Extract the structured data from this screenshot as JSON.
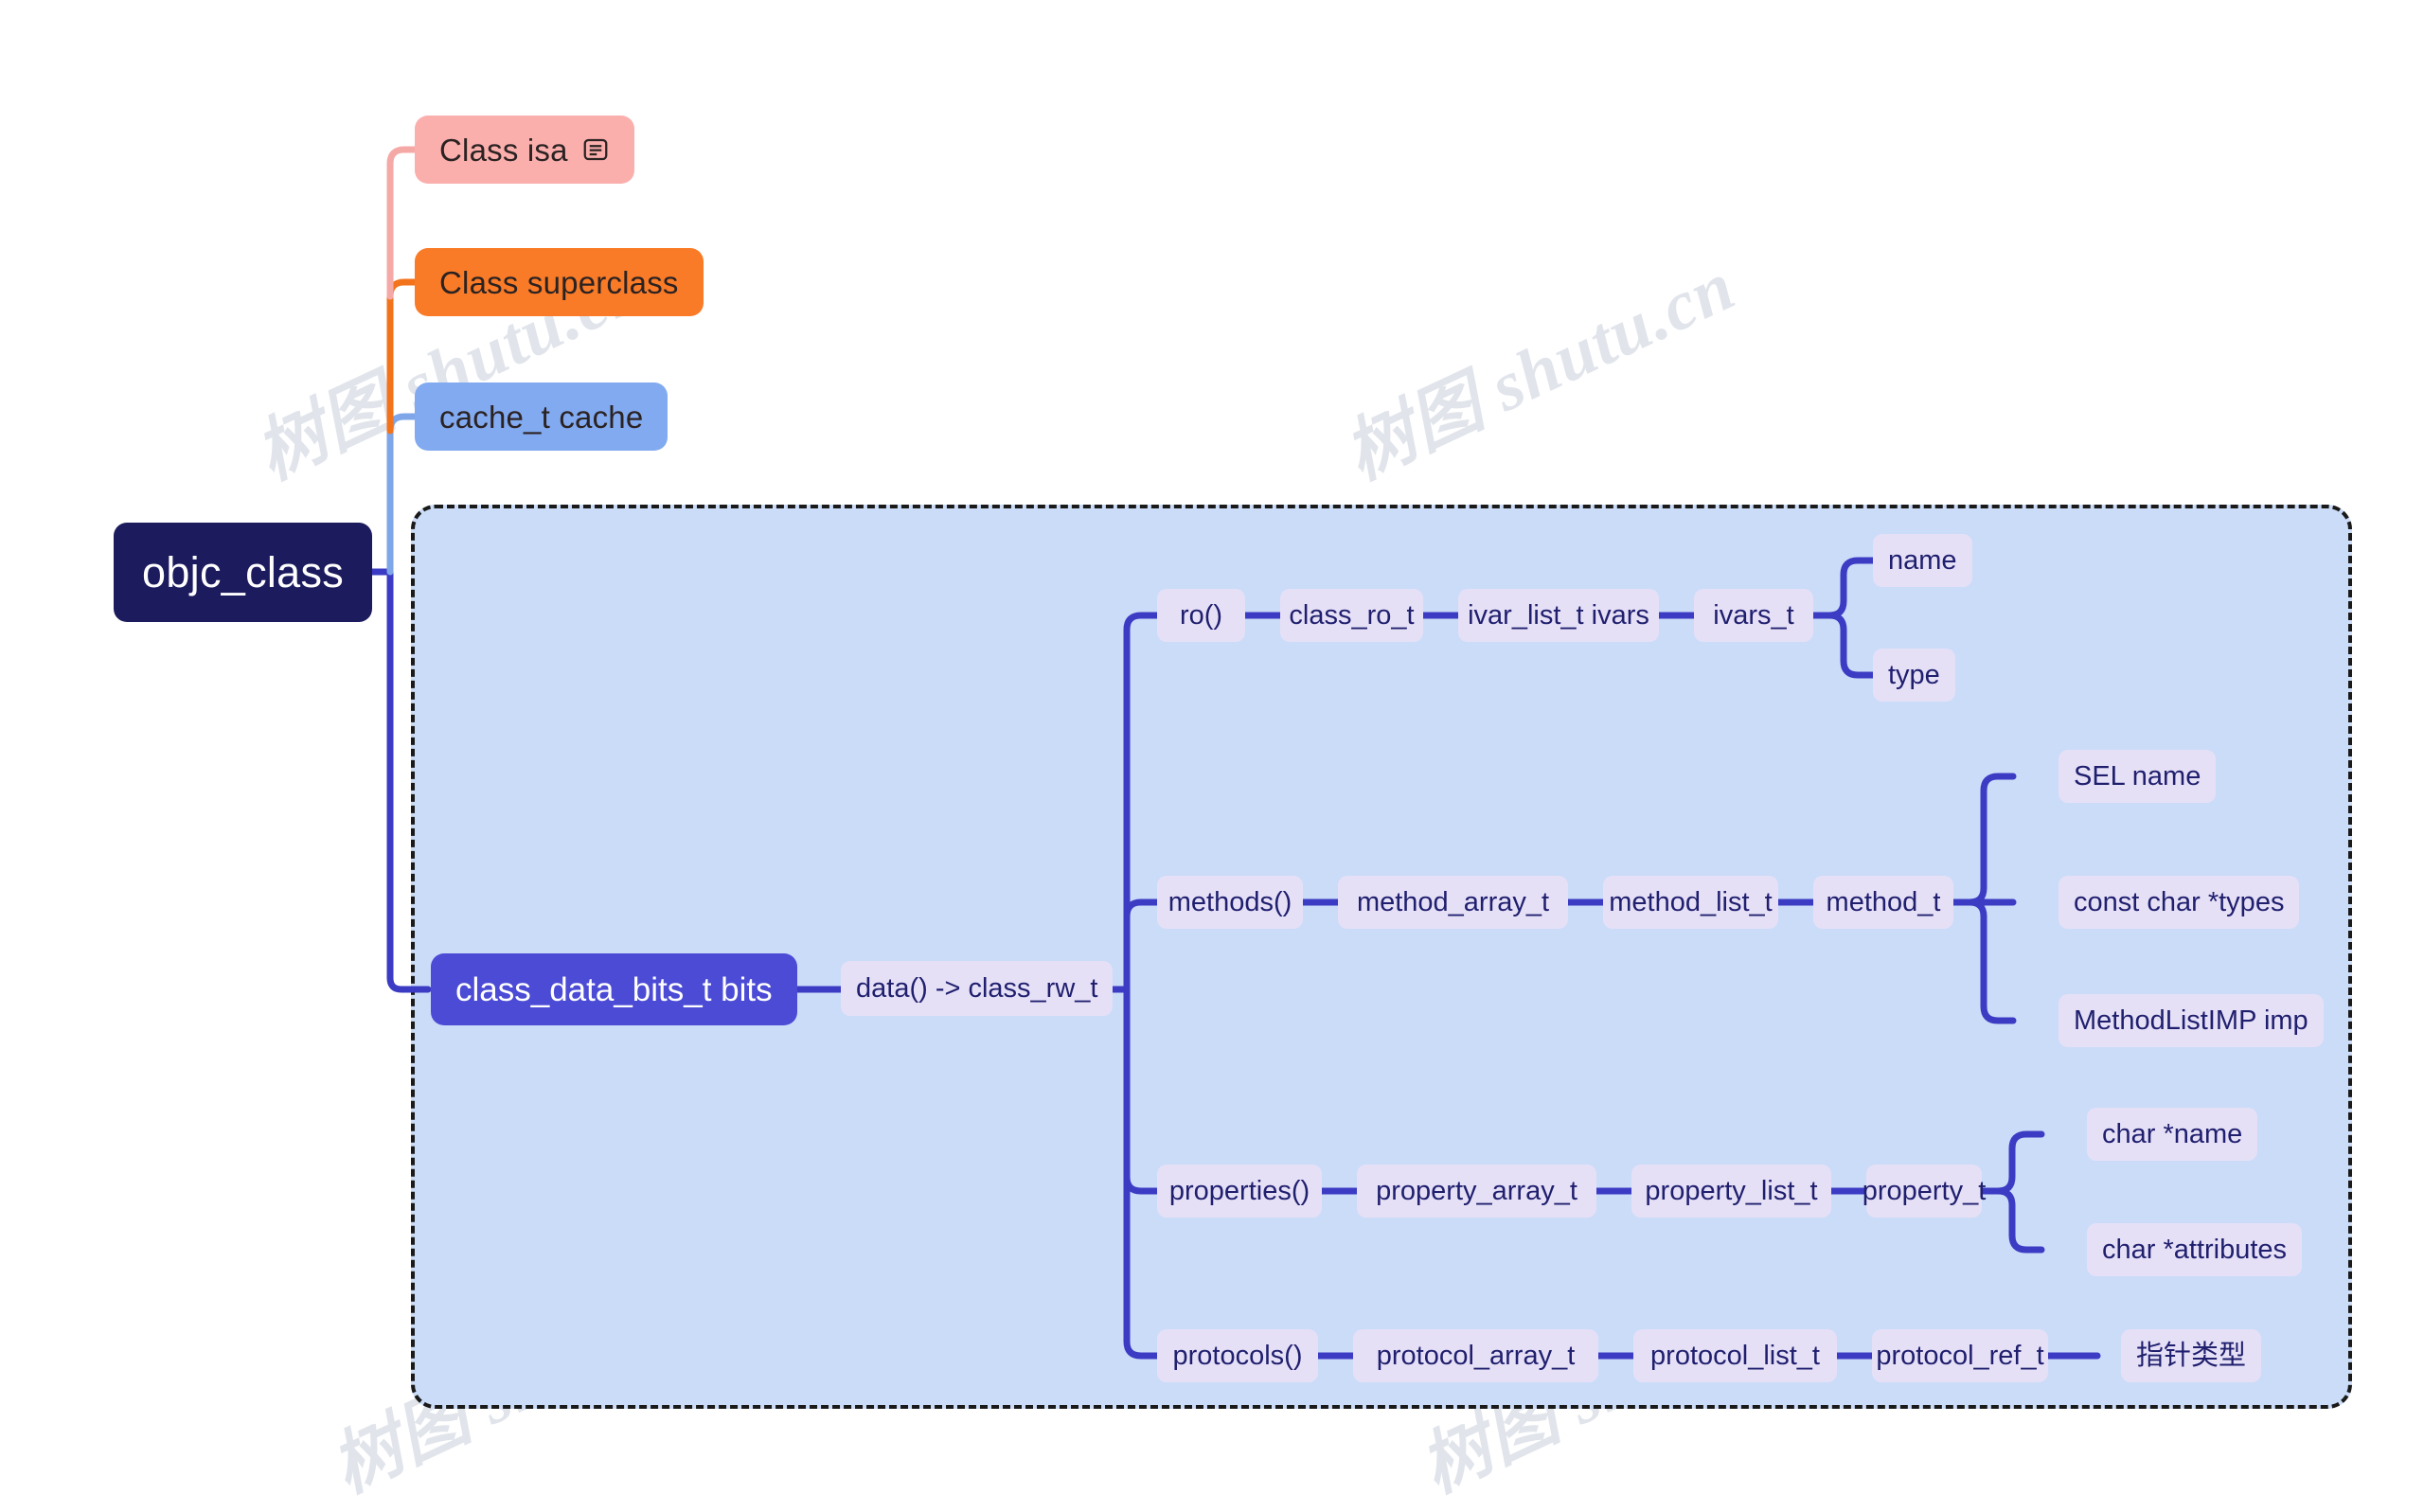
{
  "diagram": {
    "title": "objc_class structure mind map",
    "watermark_text": "树图 shutu.cn",
    "root": {
      "label": "objc_class"
    },
    "branches": [
      {
        "id": "isa",
        "label": "Class isa",
        "color": "#faafad",
        "icon": "note-icon"
      },
      {
        "id": "superclass",
        "label": "Class superclass",
        "color": "#f97b27"
      },
      {
        "id": "cache",
        "label": "cache_t cache",
        "color": "#82aaf0"
      },
      {
        "id": "bits",
        "label": "class_data_bits_t bits",
        "color": "#4b4bd6"
      }
    ],
    "data_node": {
      "label": "data() -> class_rw_t"
    },
    "chains": [
      {
        "id": "ro",
        "nodes": [
          "ro()",
          "class_ro_t",
          "ivar_list_t ivars",
          "ivars_t"
        ],
        "leaves": [
          "name",
          "type"
        ]
      },
      {
        "id": "methods",
        "nodes": [
          "methods()",
          "method_array_t",
          "method_list_t",
          "method_t"
        ],
        "leaves": [
          "SEL name",
          "const char *types",
          "MethodListIMP imp"
        ]
      },
      {
        "id": "properties",
        "nodes": [
          "properties()",
          "property_array_t",
          "property_list_t",
          "property_t"
        ],
        "leaves": [
          "char *name",
          "char *attributes"
        ]
      },
      {
        "id": "protocols",
        "nodes": [
          "protocols()",
          "protocol_array_t",
          "protocol_list_t",
          "protocol_ref_t"
        ],
        "leaves": [
          "指针类型"
        ]
      }
    ],
    "colors": {
      "root_bg": "#1b1b5e",
      "group_bg": "#cbdcf8",
      "group_border": "#1a1a1a",
      "sub_bg": "#e6e0f7",
      "sub_text": "#1f1f6e",
      "edge_blue": "#3b3bc4",
      "edge_pink": "#f5a9a7",
      "edge_orange": "#f2731c",
      "edge_lightblue": "#7ea6e8"
    }
  }
}
